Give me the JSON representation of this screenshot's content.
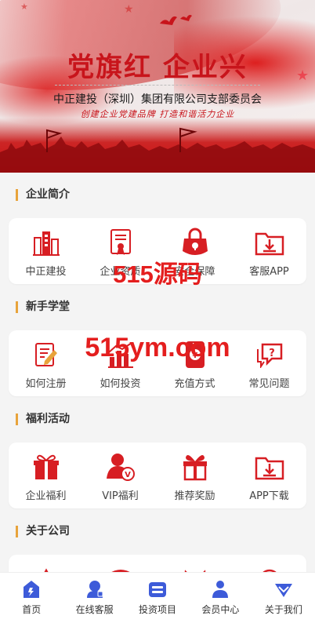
{
  "banner": {
    "title": "党旗红  企业兴",
    "subtitle": "中正建投（深圳）集团有限公司支部委员会",
    "slogan": "创建企业党建品牌   打造和谐活力企业"
  },
  "colors": {
    "accent_red": "#d71e23",
    "section_bar": "#e8a33b",
    "nav_blue": "#3d5bd9"
  },
  "sections": [
    {
      "title": "企业简介",
      "items": [
        {
          "label": "中正建投",
          "icon": "buildings-icon"
        },
        {
          "label": "企业资质",
          "icon": "certificate-icon"
        },
        {
          "label": "安全保障",
          "icon": "safe-lock-icon"
        },
        {
          "label": "客服APP",
          "icon": "download-folder-icon"
        }
      ]
    },
    {
      "title": "新手学堂",
      "items": [
        {
          "label": "如何注册",
          "icon": "register-form-icon"
        },
        {
          "label": "如何投资",
          "icon": "bar-chart-icon"
        },
        {
          "label": "充值方式",
          "icon": "phone-yen-icon"
        },
        {
          "label": "常见问题",
          "icon": "question-chat-icon"
        }
      ]
    },
    {
      "title": "福利活动",
      "items": [
        {
          "label": "企业福利",
          "icon": "gift-box-icon"
        },
        {
          "label": "VIP福利",
          "icon": "vip-user-icon"
        },
        {
          "label": "推荐奖励",
          "icon": "gift-bow-icon"
        },
        {
          "label": "APP下载",
          "icon": "download-folder-icon"
        }
      ]
    },
    {
      "title": "关于公司",
      "items": []
    }
  ],
  "watermarks": {
    "top": "515源码",
    "bottom": "515ym.com"
  },
  "tabbar": [
    {
      "label": "首页",
      "icon": "home-icon"
    },
    {
      "label": "在线客服",
      "icon": "service-icon"
    },
    {
      "label": "投资项目",
      "icon": "project-icon"
    },
    {
      "label": "会员中心",
      "icon": "member-icon"
    },
    {
      "label": "关于我们",
      "icon": "about-icon"
    }
  ]
}
